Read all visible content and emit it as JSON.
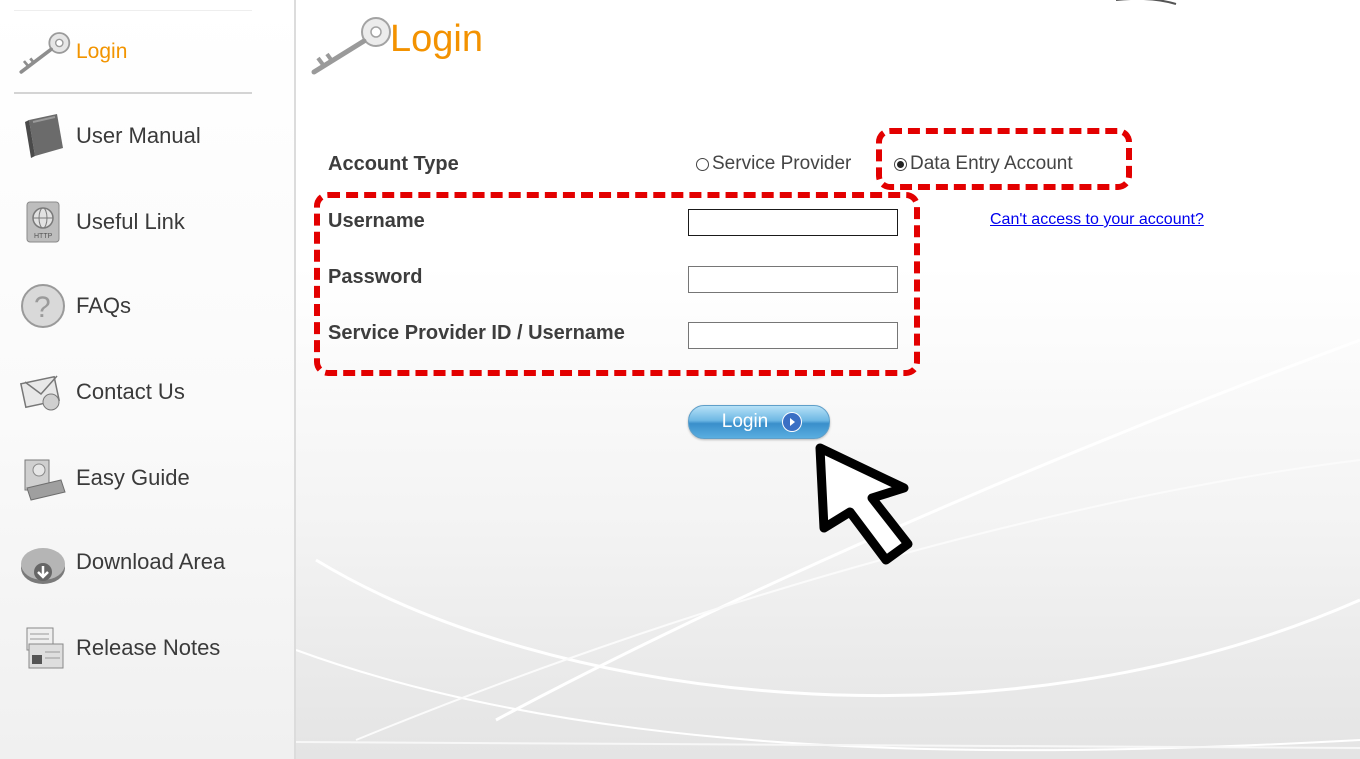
{
  "sidebar": {
    "items": [
      {
        "label": "Login",
        "icon": "key-icon",
        "active": true
      },
      {
        "label": "User Manual",
        "icon": "book-icon"
      },
      {
        "label": "Useful Link",
        "icon": "globe-icon"
      },
      {
        "label": "FAQs",
        "icon": "question-icon"
      },
      {
        "label": "Contact Us",
        "icon": "mail-icon"
      },
      {
        "label": "Easy Guide",
        "icon": "guide-icon"
      },
      {
        "label": "Download Area",
        "icon": "download-icon"
      },
      {
        "label": "Release Notes",
        "icon": "notes-icon"
      }
    ]
  },
  "main": {
    "title": "Login",
    "form": {
      "account_type_label": "Account Type",
      "radio_options": [
        {
          "label": "Service Provider",
          "checked": false
        },
        {
          "label": "Data Entry Account",
          "checked": true
        }
      ],
      "username_label": "Username",
      "username_value": "",
      "password_label": "Password",
      "password_value": "",
      "sp_id_label": "Service Provider ID / Username",
      "sp_id_value": "",
      "help_link": "Can't access to your account?",
      "login_button": "Login"
    }
  },
  "colors": {
    "accent": "#f39200",
    "annotation": "#e30000",
    "link": "#0000ee",
    "button": "#3a8fcb"
  }
}
